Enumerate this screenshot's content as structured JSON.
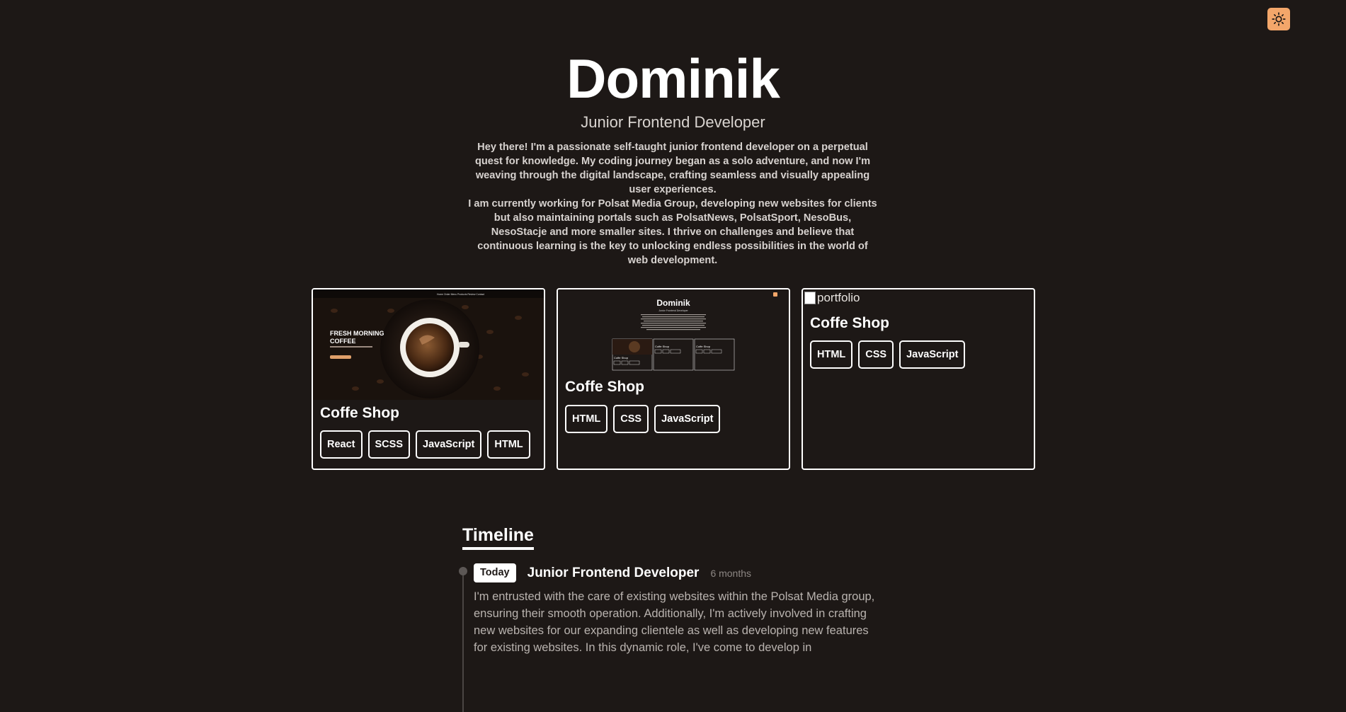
{
  "theme_toggle": {
    "icon": "sun-icon",
    "color": "#f3a66a"
  },
  "hero": {
    "name": "Dominik",
    "subtitle": "Junior Frontend Developer",
    "bio_p1": "Hey there! I'm a passionate self-taught junior frontend developer on a perpetual quest for knowledge. My coding journey began as a solo adventure, and now I'm weaving through the digital landscape, crafting seamless and visually appealing user experiences.",
    "bio_p2": "I am currently working for Polsat Media Group, developing new websites for clients but also maintaining portals such as PolsatNews, PolsatSport, NesoBus, NesoStacje and more smaller sites. I thrive on challenges and believe that continuous learning is the key to unlocking endless possibilities in the world of web development."
  },
  "projects": [
    {
      "title": "Coffe Shop",
      "tags": [
        "React",
        "SCSS",
        "JavaScript",
        "HTML"
      ],
      "thumb": {
        "nav": "Home  Order  Menu  Products  Review  Contact",
        "headline1": "FRESH MORNING",
        "headline2": "COFFEE"
      }
    },
    {
      "title": "Coffe Shop",
      "tags": [
        "HTML",
        "CSS",
        "JavaScript"
      ],
      "thumb": {
        "name": "Dominik",
        "subtitle": "Junior Frontend Developer",
        "mini_card_title": "Coffe Shop"
      }
    },
    {
      "title": "Coffe Shop",
      "tags": [
        "HTML",
        "CSS",
        "JavaScript"
      ],
      "image_alt": "portfolio"
    }
  ],
  "timeline": {
    "heading": "Timeline",
    "entries": [
      {
        "badge": "Today",
        "role": "Junior Frontend Developer",
        "duration": "6 months",
        "description": "I'm entrusted with the care of existing websites within the Polsat Media group, ensuring their smooth operation. Additionally, I'm actively involved in crafting new websites for our expanding clientele as well as developing new features for existing websites. In this dynamic role, I've come to develop in"
      }
    ]
  }
}
